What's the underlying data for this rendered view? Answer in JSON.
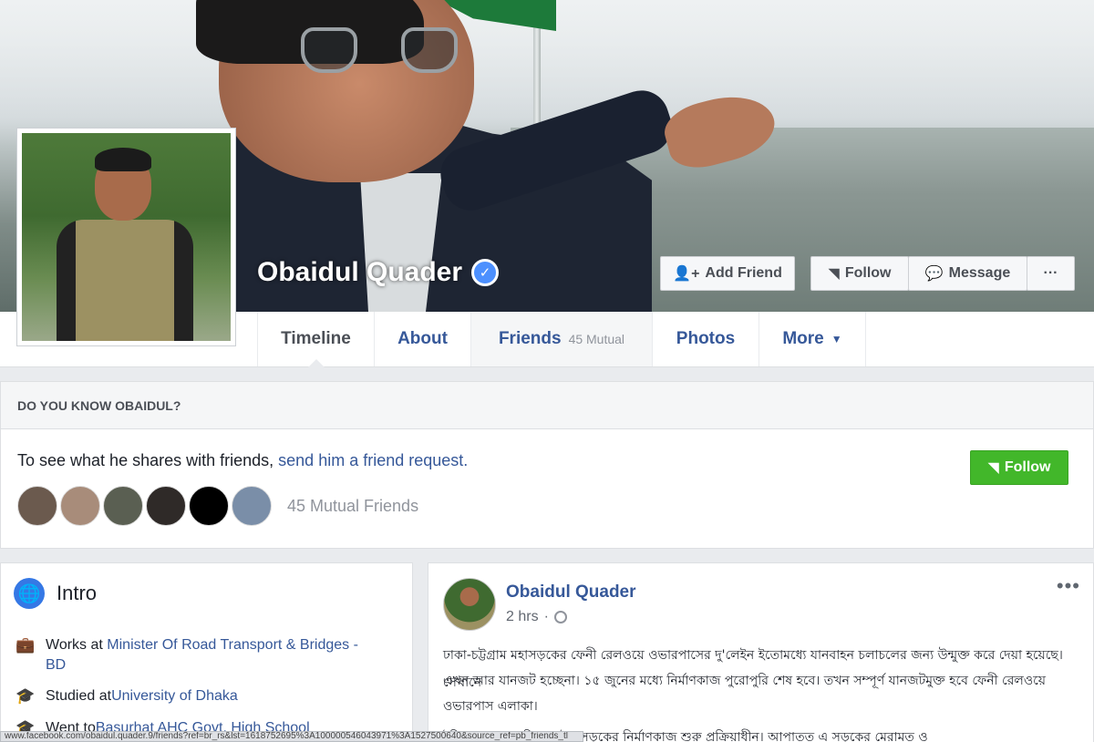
{
  "profile": {
    "name": "Obaidul Quader",
    "buttons": {
      "add_friend": "Add Friend",
      "follow": "Follow",
      "message": "Message",
      "more_dots": "···"
    }
  },
  "tabs": [
    {
      "label": "Timeline"
    },
    {
      "label": "About"
    },
    {
      "label": "Friends",
      "count": "45 Mutual"
    },
    {
      "label": "Photos"
    },
    {
      "label": "More"
    }
  ],
  "know_box": {
    "header": "DO YOU KNOW OBAIDUL?",
    "text_prefix": "To see what he shares with friends, ",
    "text_link": "send him a friend request.",
    "follow_label": "Follow",
    "mutual_label": "45 Mutual Friends",
    "avatar_colors": [
      "#6b5a4e",
      "#a88c7a",
      "#5a5f52",
      "#2f2a28",
      "#000000",
      "#7a8ea8"
    ]
  },
  "intro": {
    "title": "Intro",
    "items": [
      {
        "prefix": "Works at ",
        "link": "Minister Of Road Transport & Bridges - BD",
        "icon": "briefcase-icon"
      },
      {
        "prefix": "Studied at ",
        "link": "University of Dhaka",
        "icon": "graduation-cap-icon"
      },
      {
        "prefix": "Went to ",
        "link": "Basurhat AHC Govt. High School",
        "icon": "graduation-cap-icon"
      }
    ]
  },
  "post": {
    "author": "Obaidul Quader",
    "time": "2 hrs",
    "more": "•••",
    "paragraph1_line1": "ঢাকা-চট্টগ্রাম মহাসড়কের ফেনী রেলওয়ে ওভারপাসের দু'লেইন ইতোমধ্যে যানবাহন চলাচলের জন্য উন্মুক্ত করে দেয়া হয়েছে। সেখানে",
    "paragraph1_line2": "এখন আর যানজট হচ্ছেনা। ১৫ জুনের মধ্যে নির্মাণকাজ পুরোপুরি শেষ হবে। তখন সম্পূর্ণ যানজটমুক্ত হবে ফেনী রেলওয়ে",
    "paragraph1_line3": "ওভারপাস এলাকা।",
    "paragraph2_line1": "ইতিমধ্যে ময়নামতি-সরাইল সড়কের নির্মাণকাজ শুরু প্রক্রিয়াধীন। আপাতত এ সড়কের মেরামত ও"
  },
  "status_bar": "www.facebook.com/obaidul.quader.9/friends?ref=br_rs&lst=1618752695%3A100000546043971%3A1527500640&source_ref=pb_friends_tl"
}
